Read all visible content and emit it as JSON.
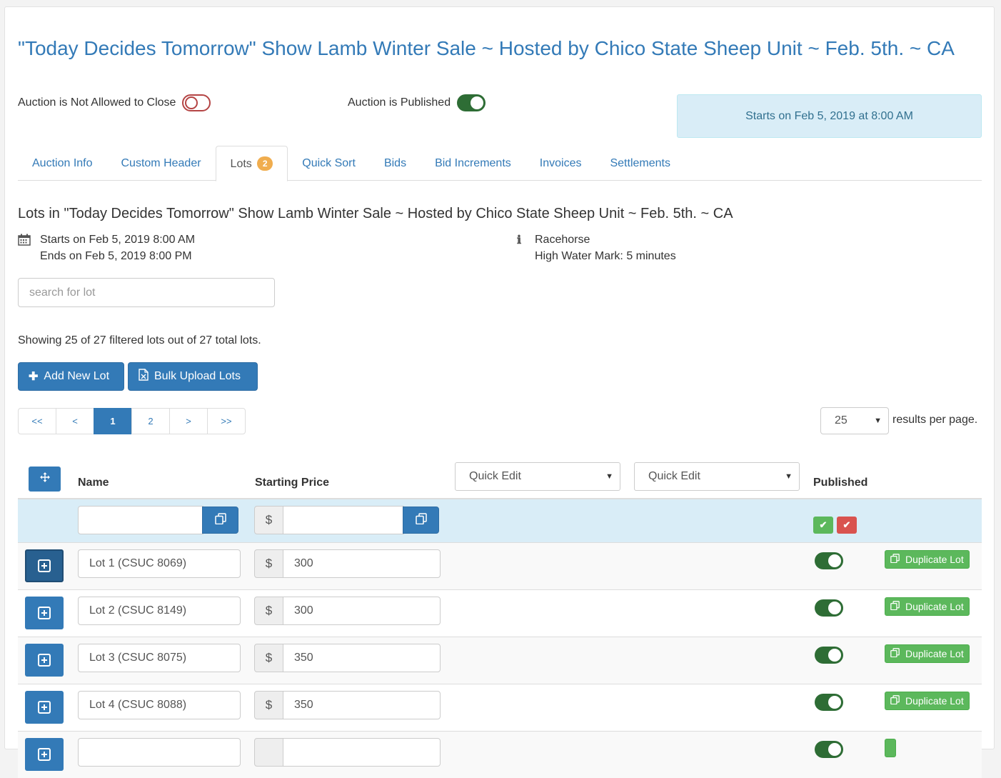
{
  "page": {
    "title": "\"Today Decides Tomorrow\" Show Lamb Winter Sale ~ Hosted by Chico State Sheep Unit ~ Feb. 5th. ~ CA"
  },
  "toggles": {
    "close_label": "Auction is Not Allowed to Close",
    "close_on": false,
    "published_label": "Auction is Published",
    "published_on": true
  },
  "starts_banner": "Starts on Feb 5, 2019 at 8:00 AM",
  "tabs": [
    {
      "label": "Auction Info"
    },
    {
      "label": "Custom Header"
    },
    {
      "label": "Lots",
      "badge": "2",
      "active": true
    },
    {
      "label": "Quick Sort"
    },
    {
      "label": "Bids"
    },
    {
      "label": "Bid Increments"
    },
    {
      "label": "Invoices"
    },
    {
      "label": "Settlements"
    }
  ],
  "lots_heading": "Lots in \"Today Decides Tomorrow\" Show Lamb Winter Sale ~ Hosted by Chico State Sheep Unit ~ Feb. 5th. ~ CA",
  "schedule": {
    "starts": "Starts on Feb 5, 2019 8:00 AM",
    "ends": "Ends on Feb 5, 2019 8:00 PM"
  },
  "auction_type": {
    "type": "Racehorse",
    "high_water": "High Water Mark: 5 minutes"
  },
  "search": {
    "placeholder": "search for lot",
    "value": ""
  },
  "showing_text": "Showing 25 of 27 filtered lots out of 27 total lots.",
  "buttons": {
    "add_lot": "Add New Lot",
    "bulk_upload": "Bulk Upload Lots"
  },
  "pagination": {
    "first": "<<",
    "prev": "<",
    "pages": [
      "1",
      "2"
    ],
    "current": "1",
    "next": ">",
    "last": ">>"
  },
  "per_page": {
    "value": "25",
    "label": "results per page."
  },
  "table": {
    "col_name": "Name",
    "col_price": "Starting Price",
    "quick_edit_1": "Quick Edit",
    "quick_edit_2": "Quick Edit",
    "col_published": "Published",
    "currency": "$",
    "duplicate_label": "Duplicate Lot",
    "rows": [
      {
        "name": "Lot 1 (CSUC 8069)",
        "price": "300",
        "published": true
      },
      {
        "name": "Lot 2 (CSUC 8149)",
        "price": "300",
        "published": true
      },
      {
        "name": "Lot 3 (CSUC 8075)",
        "price": "350",
        "published": true
      },
      {
        "name": "Lot 4 (CSUC 8088)",
        "price": "350",
        "published": true
      }
    ]
  },
  "colors": {
    "primary": "#337ab7",
    "success": "#5cb85c",
    "danger": "#d9534f",
    "toggle_on": "#2e6d35",
    "toggle_off": "#b44444",
    "info_bg": "#d9edf7"
  },
  "icons": {
    "move": "move-icon",
    "copy": "copy-icon",
    "calendar": "calendar-icon",
    "info": "info-icon",
    "plus": "plus-icon",
    "upload": "excel-file-icon",
    "expand": "plus-square-icon",
    "check": "check-icon"
  }
}
